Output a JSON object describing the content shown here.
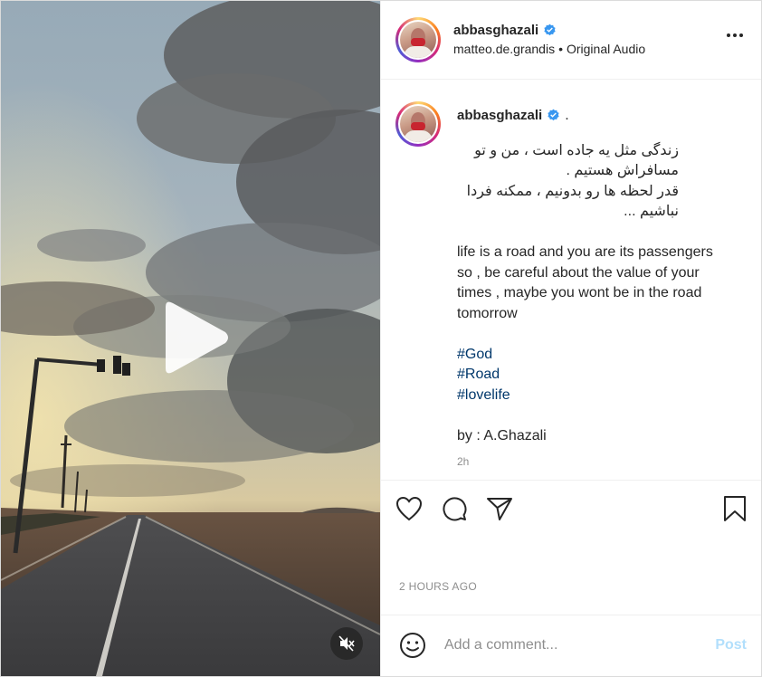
{
  "post": {
    "username": "abbasghazali",
    "verified": true,
    "audio_user": "matteo.de.grandis",
    "audio_separator": "•",
    "audio_label": "Original Audio",
    "caption_suffix": ".",
    "caption_farsi": [
      "زندگی مثل یه جاده است ، من و تو مسافراش هستیم .",
      "قدر لحظه ها رو بدونیم ، ممکنه فردا نباشیم ..."
    ],
    "caption_english": "life is a road and you are its passengers so , be careful about the value of your times , maybe you wont be in the road tomorrow",
    "hashtags": [
      "#God",
      "#Road",
      "#lovelife"
    ],
    "signature": "by : A.Ghazali",
    "relative_time": "2h",
    "timestamp": "2 HOURS AGO"
  },
  "comment": {
    "placeholder": "Add a comment...",
    "post_label": "Post"
  },
  "icons": {
    "verified": "verified-badge-icon",
    "more": "more-options-icon",
    "like": "heart-icon",
    "comment": "comment-bubble-icon",
    "share": "paper-plane-icon",
    "save": "bookmark-icon",
    "emoji": "smiley-icon",
    "play": "play-icon",
    "mute": "speaker-muted-icon"
  },
  "colors": {
    "verified_blue": "#3897f0",
    "hashtag": "#00376b",
    "post_disabled": "#b2dffc"
  }
}
